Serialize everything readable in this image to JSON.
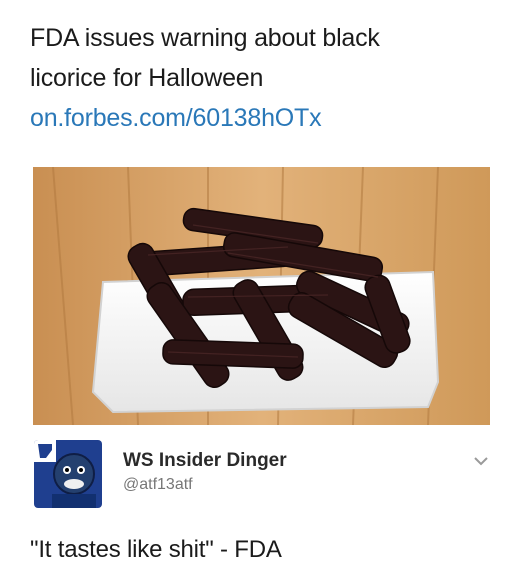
{
  "tweet": {
    "line1": "FDA issues warning about black",
    "line2": "licorice for Halloween",
    "link": "on.forbes.com/60138hOTx"
  },
  "author": {
    "display_name": "WS Insider Dinger",
    "handle": "@atf13atf"
  },
  "reply": {
    "text": "\"It tastes like shit\" - FDA"
  },
  "colors": {
    "link": "#2a78b8",
    "text": "#1b1b1b",
    "handle": "#777777",
    "licorice": "#2b1414",
    "wood": "#d9a56a"
  },
  "icons": {
    "menu": "chevron-down-icon"
  }
}
